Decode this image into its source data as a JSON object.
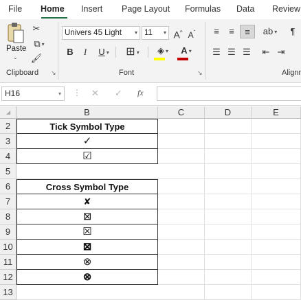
{
  "menu": {
    "tabs": [
      "File",
      "Home",
      "Insert",
      "Page Layout",
      "Formulas",
      "Data",
      "Review"
    ],
    "active": "Home"
  },
  "ribbon": {
    "clipboard": {
      "paste_label": "Paste",
      "group_label": "Clipboard"
    },
    "font": {
      "font_name": "Univers 45 Light",
      "font_size": "11",
      "bold": "B",
      "italic": "I",
      "underline": "U",
      "grow": "A",
      "shrink": "A",
      "group_label": "Font"
    },
    "alignment": {
      "group_label": "Alignm"
    }
  },
  "formula_bar": {
    "name_box": "H16",
    "cancel": "✕",
    "enter": "✓",
    "fx": "fx",
    "value": ""
  },
  "grid": {
    "columns": [
      "B",
      "C",
      "D",
      "E"
    ],
    "rows": [
      "2",
      "3",
      "4",
      "5",
      "6",
      "7",
      "8",
      "9",
      "10",
      "11",
      "12",
      "13"
    ],
    "cells_b": [
      "Tick Symbol Type",
      "✓",
      "☑",
      "",
      "Cross Symbol Type",
      "✘",
      "⊠",
      "☒",
      "⊠",
      "⊗",
      "⊗",
      ""
    ]
  },
  "colors": {
    "accent": "#217346",
    "ribbon_bg": "#f3f3f3",
    "font_color_bar": "#c00000",
    "highlight_bar": "#ffff00"
  }
}
